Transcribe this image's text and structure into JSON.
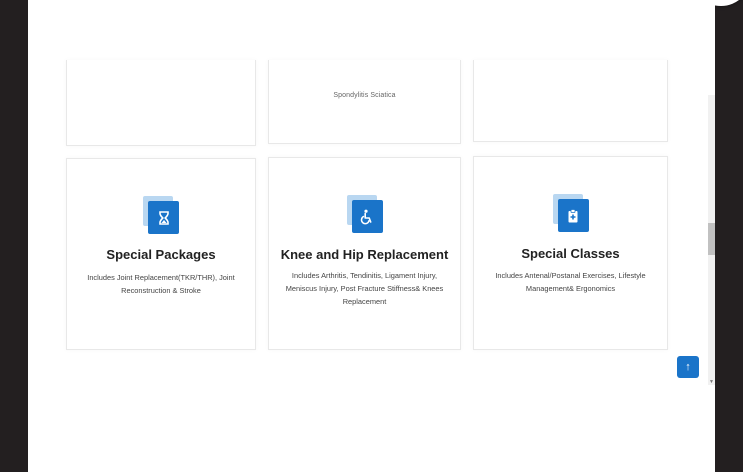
{
  "top_row": {
    "middle_text": "Spondylitis Sciatica"
  },
  "cards": [
    {
      "icon": "hourglass-icon",
      "title": "Special Packages",
      "description": "Includes Joint Replacement(TKR/THR), Joint Reconstruction & Stroke"
    },
    {
      "icon": "wheelchair-icon",
      "title": "Knee and Hip Replacement",
      "description": "Includes Arthritis, Tendinitis, Ligament Injury, Meniscus Injury, Post Fracture Stiffness& Knees Replacement"
    },
    {
      "icon": "medical-clipboard-icon",
      "title": "Special Classes",
      "description": "Includes Antenal/Postanal Exercises, Lifestyle Management& Ergonomics"
    }
  ],
  "scroll_top": {
    "icon": "arrow-up-icon",
    "glyph": "↑"
  },
  "colors": {
    "accent": "#1a74c9",
    "accent_light": "#b9d7f1",
    "frame": "#231f20"
  }
}
